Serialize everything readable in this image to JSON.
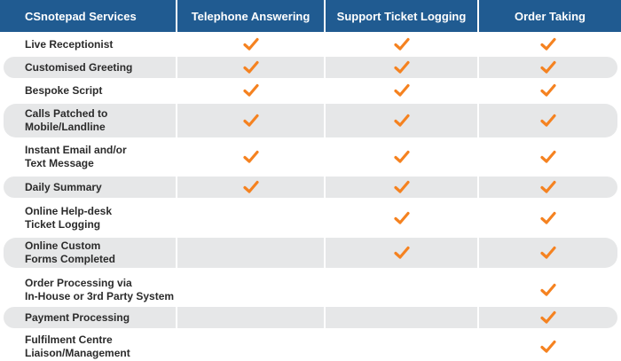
{
  "header": {
    "col0": "CSnotepad Services",
    "col1": "Telephone Answering",
    "col2": "Support Ticket Logging",
    "col3": "Order Taking"
  },
  "accent_color": "#f58220",
  "header_color": "#205b91",
  "icon": "checkmark-icon",
  "rows": [
    {
      "label": "Live Receptionist",
      "checks": [
        true,
        true,
        true
      ]
    },
    {
      "label": "Customised Greeting",
      "checks": [
        true,
        true,
        true
      ]
    },
    {
      "label": "Bespoke Script",
      "checks": [
        true,
        true,
        true
      ]
    },
    {
      "label": "Calls Patched to\nMobile/Landline",
      "checks": [
        true,
        true,
        true
      ]
    },
    {
      "label": "Instant Email and/or\nText Message",
      "checks": [
        true,
        true,
        true
      ]
    },
    {
      "label": "Daily Summary",
      "checks": [
        true,
        true,
        true
      ]
    },
    {
      "label": "Online Help-desk\nTicket Logging",
      "checks": [
        false,
        true,
        true
      ]
    },
    {
      "label": "Online Custom\nForms Completed",
      "checks": [
        false,
        true,
        true
      ]
    },
    {
      "label": "Order Processing via\nIn-House or 3rd Party System",
      "checks": [
        false,
        false,
        true
      ]
    },
    {
      "label": "Payment Processing",
      "checks": [
        false,
        false,
        true
      ]
    },
    {
      "label": "Fulfilment Centre\nLiaison/Management",
      "checks": [
        false,
        false,
        true
      ]
    }
  ]
}
